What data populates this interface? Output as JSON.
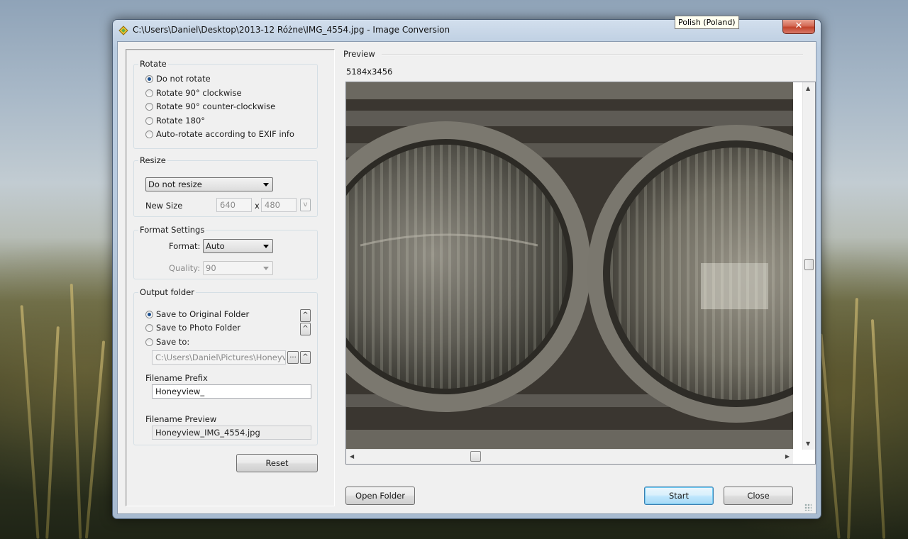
{
  "tooltip": "Polish (Poland)",
  "window": {
    "title": "C:\\Users\\Daniel\\Desktop\\2013-12 Różne\\IMG_4554.jpg - Image Conversion",
    "close_glyph": "✕"
  },
  "rotate": {
    "label": "Rotate",
    "options": [
      {
        "label": "Do not rotate",
        "checked": true
      },
      {
        "label": "Rotate 90° clockwise",
        "checked": false
      },
      {
        "label": "Rotate 90° counter-clockwise",
        "checked": false
      },
      {
        "label": "Rotate 180°",
        "checked": false
      },
      {
        "label": "Auto-rotate according to EXIF info",
        "checked": false
      }
    ]
  },
  "resize": {
    "label": "Resize",
    "mode": "Do not resize",
    "new_size_label": "New Size",
    "width": "640",
    "x_sep": "x",
    "height": "480",
    "v_button": "v"
  },
  "format_settings": {
    "label": "Format Settings",
    "format_label": "Format:",
    "format_value": "Auto",
    "quality_label": "Quality:",
    "quality_value": "90"
  },
  "output": {
    "label": "Output folder",
    "options": [
      {
        "label": "Save to Original Folder",
        "checked": true
      },
      {
        "label": "Save to Photo Folder",
        "checked": false
      },
      {
        "label": "Save to:",
        "checked": false
      }
    ],
    "path": "C:\\Users\\Daniel\\Pictures\\Honeyview",
    "browse_label": "...",
    "up_glyph": "^",
    "prefix_label": "Filename Prefix",
    "prefix_value": "Honeyview_",
    "fname_preview_label": "Filename Preview",
    "fname_preview_value": "Honeyview_IMG_4554.jpg"
  },
  "buttons": {
    "reset": "Reset",
    "open_folder": "Open Folder",
    "start": "Start",
    "close": "Close"
  },
  "preview": {
    "label": "Preview",
    "dimensions": "5184x3456"
  },
  "icons": {
    "scroll_up": "▲",
    "scroll_down": "▼",
    "scroll_left": "◀",
    "scroll_right": "▶"
  }
}
